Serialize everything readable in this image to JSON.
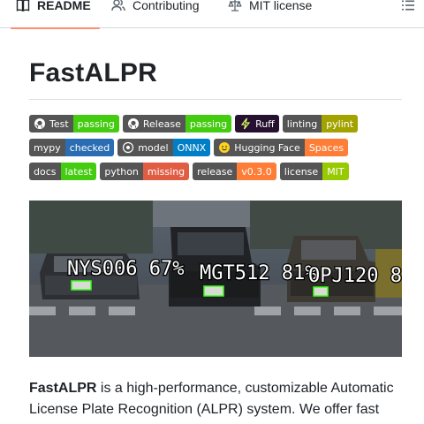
{
  "tabs": [
    {
      "label": "README",
      "icon": "book-icon",
      "active": true
    },
    {
      "label": "Contributing",
      "icon": "people-icon",
      "active": false
    },
    {
      "label": "MIT license",
      "icon": "law-scale-icon",
      "active": false
    }
  ],
  "toc_icon": "list-unordered-icon",
  "title": "FastALPR",
  "badges": {
    "row1": [
      {
        "label": "Test",
        "message": "passing",
        "color": "#44cc11",
        "logo": "github-icon"
      },
      {
        "label": "Release",
        "message": "passing",
        "color": "#44cc11",
        "logo": "github-icon"
      },
      {
        "label": "Ruff",
        "message": "",
        "color": "#261230",
        "logo": "ruff-icon"
      },
      {
        "label": "linting",
        "message": "pylint",
        "color": "#a3a300",
        "logo": ""
      }
    ],
    "row2": [
      {
        "label": "mypy",
        "message": "checked",
        "color": "#2a6db2",
        "logo": ""
      },
      {
        "label": "model",
        "message": "ONNX",
        "color": "#007ec6",
        "logo": "onnx-icon"
      },
      {
        "label": "Hugging Face",
        "message": "Spaces",
        "color": "#fe7d37",
        "logo": "hugging-face-icon"
      }
    ],
    "row3": [
      {
        "label": "docs",
        "message": "latest",
        "color": "#4c1",
        "logo": ""
      },
      {
        "label": "python",
        "message": "missing",
        "color": "#e05d44",
        "logo": ""
      },
      {
        "label": "release",
        "message": "v0.3.0",
        "color": "#fe7d37",
        "logo": ""
      },
      {
        "label": "license",
        "message": "MIT",
        "color": "#97ca00",
        "logo": ""
      }
    ]
  },
  "demo": {
    "detections": [
      {
        "text": "NYS006 67%"
      },
      {
        "text": "MGT512 81%"
      },
      {
        "text": "OPJ120 8"
      }
    ],
    "box_color": "#39ff14"
  },
  "description": {
    "bold": "FastALPR",
    "rest": " is a high-performance, customizable Automatic License Plate Recognition (ALPR) system. We offer fast"
  }
}
